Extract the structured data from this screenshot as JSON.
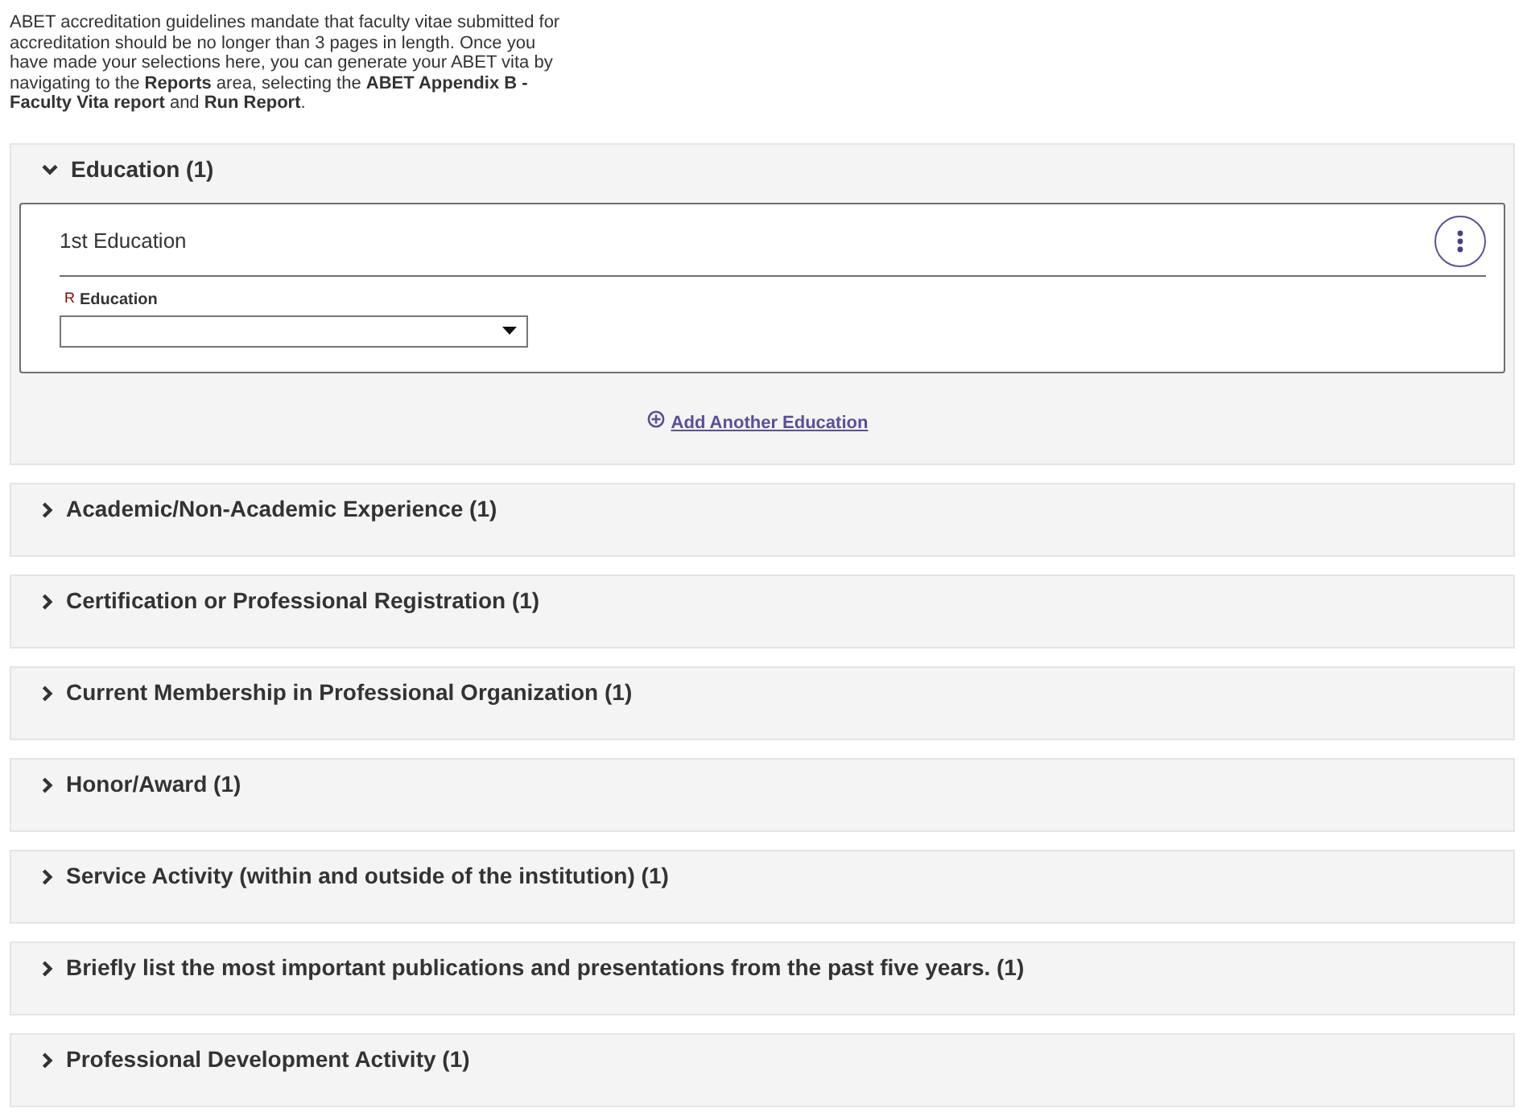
{
  "intro": "ABET accreditation guidelines mandate that faculty vitae submitted for accreditation should be no longer than 3 pages in length. Once you have made your selections here, you can generate your ABET vita by navigating to the **Reports** area, selecting the **ABET Appendix B - Faculty Vita report** and **Run Report**.",
  "sections": [
    {
      "title": "Education (1)",
      "expanded": true,
      "entries": [
        {
          "title": "1st Education",
          "fields": [
            {
              "required_mark": "R",
              "label": "Education"
            }
          ]
        }
      ],
      "add_link": "Add Another Education"
    },
    {
      "title": "Academic/Non-Academic Experience (1)",
      "expanded": false
    },
    {
      "title": "Certification or Professional Registration (1)",
      "expanded": false
    },
    {
      "title": "Current Membership in Professional Organization (1)",
      "expanded": false
    },
    {
      "title": "Honor/Award (1)",
      "expanded": false
    },
    {
      "title": "Service Activity (within and outside of the institution) (1)",
      "expanded": false
    },
    {
      "title": "Briefly list the most important publications and presentations from the past five years. (1)",
      "expanded": false
    },
    {
      "title": "Professional Development Activity (1)",
      "expanded": false
    }
  ]
}
